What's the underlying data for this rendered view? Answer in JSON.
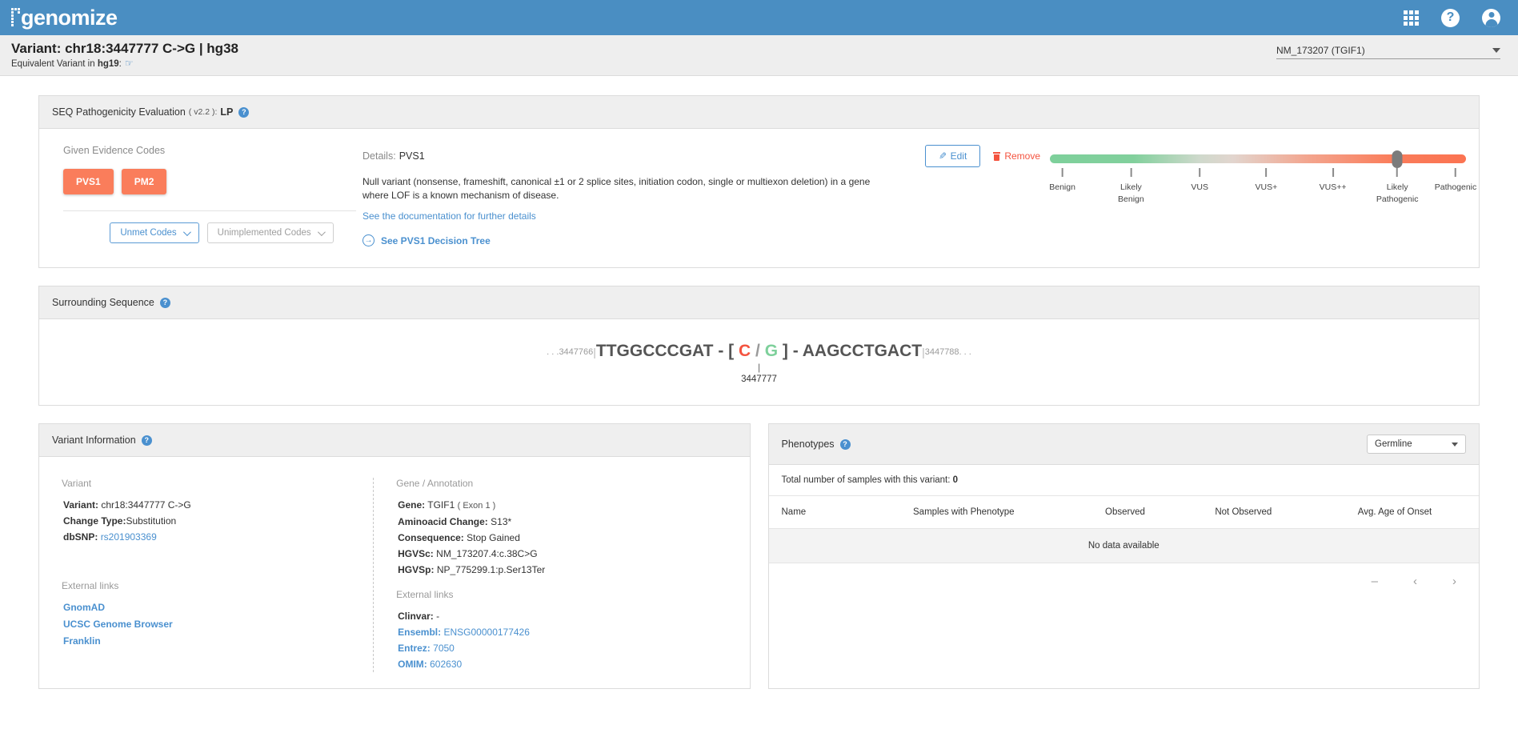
{
  "brand": {
    "name": "genomize"
  },
  "topbar": {
    "apps_icon": "grid-apps-icon",
    "help_icon": "help-icon",
    "help_glyph": "?",
    "account_icon": "account-icon"
  },
  "subheader": {
    "title": "Variant: chr18:3447777 C->G | hg38",
    "equivalent_prefix": "Equivalent Variant in ",
    "equivalent_build": "hg19",
    "equivalent_suffix": ":",
    "hand_icon": "pointing-hand-icon",
    "transcript_value": "NM_173207 (TGIF1)"
  },
  "pathogenicity": {
    "title_prefix": "SEQ Pathogenicity Evaluation",
    "version": "( v2.2 ):",
    "classification": "LP",
    "help_icon": "help-icon",
    "given_codes_label": "Given Evidence Codes",
    "codes": [
      {
        "label": "PVS1",
        "color": "#fa7d5b"
      },
      {
        "label": "PM2",
        "color": "#fa7d5b"
      }
    ],
    "unmet_button": "Unmet Codes",
    "unimplemented_button": "Unimplemented Codes",
    "details_label": "Details:",
    "details_code": "PVS1",
    "edit_label": "Edit",
    "remove_label": "Remove",
    "description": "Null variant (nonsense, frameshift, canonical ±1 or 2 splice sites, initiation codon, single or multiexon deletion) in a gene where LOF is a known mechanism of disease.",
    "doc_link": "See the documentation for further details",
    "tree_link": "See PVS1 Decision Tree",
    "scale": {
      "ticks": [
        {
          "label": "Benign",
          "pct": 3
        },
        {
          "label": "Likely\nBenign",
          "pct": 19.5
        },
        {
          "label": "VUS",
          "pct": 36
        },
        {
          "label": "VUS+",
          "pct": 52
        },
        {
          "label": "VUS++",
          "pct": 68
        },
        {
          "label": "Likely\nPathogenic",
          "pct": 83.5
        },
        {
          "label": "Pathogenic",
          "pct": 97.5
        }
      ],
      "thumb_pct": 83.5,
      "color_benign": "#7ed09b",
      "color_pathogenic": "#fb7351"
    }
  },
  "surrounding_sequence": {
    "title": "Surrounding Sequence",
    "help_icon": "help-icon",
    "start_pos": "3447766",
    "left_bases": "TTGGCCCGAT",
    "ref": "C",
    "alt": "G",
    "right_bases": "AAGCCTGACT",
    "end_pos": "3447788",
    "variant_pos": "3447777",
    "ellipsis": ". . ."
  },
  "variant_information": {
    "title": "Variant Information",
    "help_icon": "help-icon",
    "variant_section_label": "Variant",
    "rows": [
      {
        "label": "Variant:",
        "value": "chr18:3447777 C->G",
        "link": false
      },
      {
        "label": "Change Type:",
        "value": "Substitution",
        "link": false
      },
      {
        "label": "dbSNP:",
        "value": "rs201903369",
        "link": true
      }
    ],
    "external_links_label": "External links",
    "external_links": [
      "GnomAD",
      "UCSC Genome Browser",
      "Franklin"
    ],
    "gene_section_label": "Gene / Annotation",
    "gene_rows": [
      {
        "label": "Gene:",
        "value": "TGIF1",
        "extra": "( Exon 1 )"
      },
      {
        "label": "Aminoacid Change:",
        "value": "S13*",
        "extra": ""
      },
      {
        "label": "Consequence:",
        "value": "Stop Gained",
        "extra": ""
      },
      {
        "label": "HGVSc:",
        "value": "NM_173207.4:c.38C>G",
        "extra": ""
      },
      {
        "label": "HGVSp:",
        "value": "NP_775299.1:p.Ser13Ter",
        "extra": ""
      }
    ],
    "gene_links_label": "External links",
    "gene_links": [
      {
        "label": "Clinvar:",
        "value": "-",
        "link": false
      },
      {
        "label": "Ensembl:",
        "value": "ENSG00000177426",
        "link": true
      },
      {
        "label": "Entrez:",
        "value": "7050",
        "link": true
      },
      {
        "label": "OMIM:",
        "value": "602630",
        "link": true
      }
    ]
  },
  "phenotypes": {
    "title": "Phenotypes",
    "help_icon": "help-icon",
    "filter_value": "Germline",
    "total_label": "Total number of samples with this variant:",
    "total_value": "0",
    "columns": [
      "Name",
      "Samples with Phenotype",
      "Observed",
      "Not Observed",
      "Avg. Age of Onset"
    ],
    "no_data": "No data available",
    "pager": {
      "dash": "–",
      "prev": "‹",
      "next": "›"
    }
  }
}
